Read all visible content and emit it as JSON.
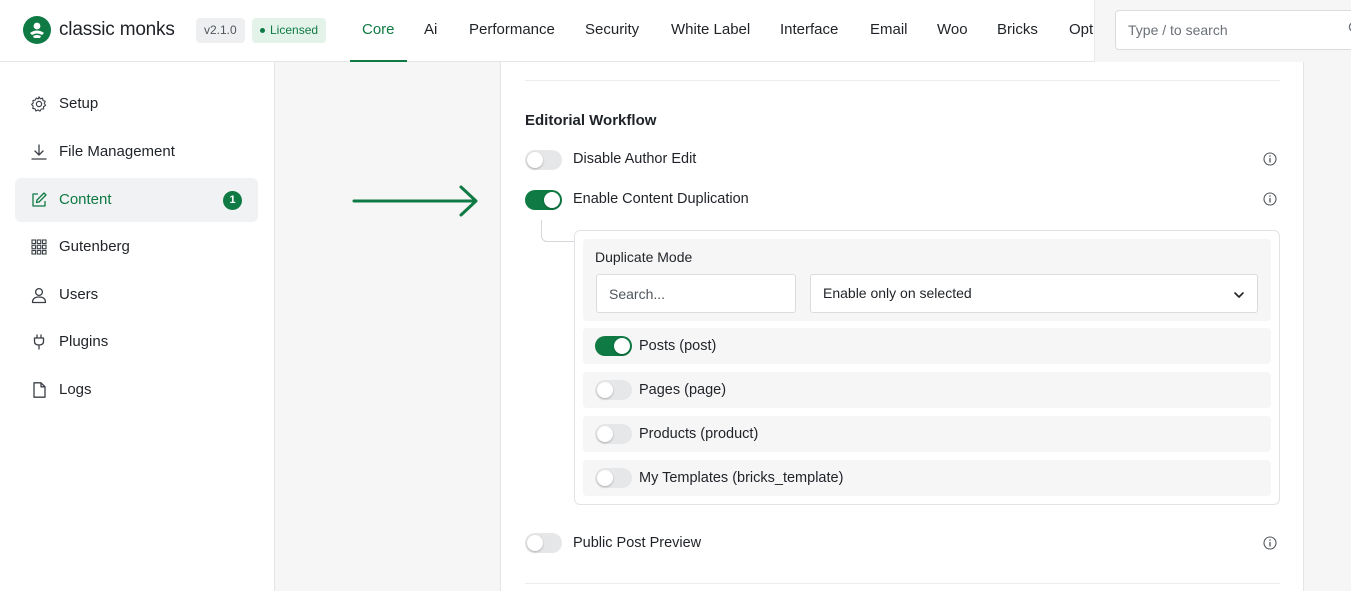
{
  "brand": {
    "name": "classic monks",
    "version": "v2.1.0",
    "license_status": "Licensed",
    "accent_color": "#0f7a43"
  },
  "nav": {
    "tabs": [
      {
        "label": "Core",
        "active": true
      },
      {
        "label": "Ai"
      },
      {
        "label": "Performance"
      },
      {
        "label": "Security"
      },
      {
        "label": "White Label"
      },
      {
        "label": "Interface"
      },
      {
        "label": "Email"
      },
      {
        "label": "Woo"
      },
      {
        "label": "Bricks"
      },
      {
        "label": "Opt"
      }
    ]
  },
  "search": {
    "placeholder": "Type / to search",
    "icon": "search-icon"
  },
  "sidebar": {
    "items": [
      {
        "label": "Setup",
        "icon": "gear-icon"
      },
      {
        "label": "File Management",
        "icon": "download-icon"
      },
      {
        "label": "Content",
        "icon": "edit-icon",
        "active": true,
        "count": "1"
      },
      {
        "label": "Gutenberg",
        "icon": "grid-icon"
      },
      {
        "label": "Users",
        "icon": "user-icon"
      },
      {
        "label": "Plugins",
        "icon": "plug-icon"
      },
      {
        "label": "Logs",
        "icon": "file-icon"
      }
    ]
  },
  "main": {
    "section_title": "Editorial Workflow",
    "settings": [
      {
        "label": "Disable Author Edit",
        "enabled": false,
        "icon": "info-icon"
      },
      {
        "label": "Enable Content Duplication",
        "enabled": true,
        "icon": "info-icon"
      },
      {
        "label": "Public Post Preview",
        "enabled": false,
        "icon": "info-icon"
      }
    ],
    "duplication": {
      "mode_label": "Duplicate Mode",
      "filter_placeholder": "Search...",
      "mode_value": "Enable only on selected",
      "post_types": [
        {
          "label": "Posts (post)",
          "enabled": true
        },
        {
          "label": "Pages (page)",
          "enabled": false
        },
        {
          "label": "Products (product)",
          "enabled": false
        },
        {
          "label": "My Templates (bricks_template)",
          "enabled": false
        }
      ]
    }
  }
}
